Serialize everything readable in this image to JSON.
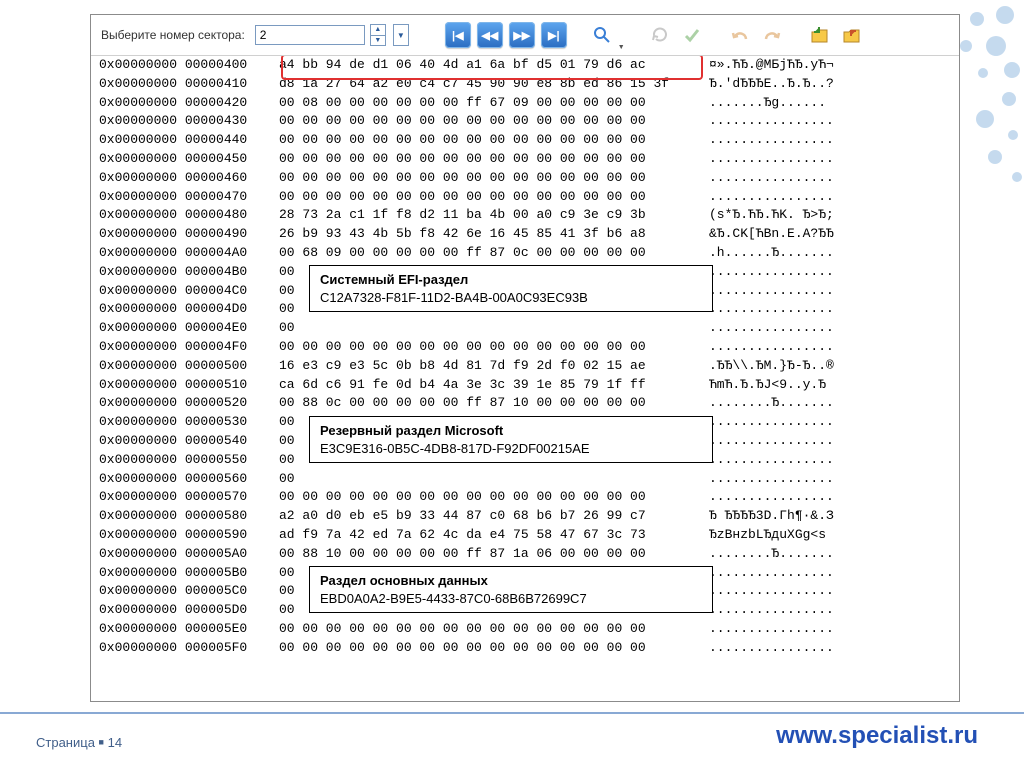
{
  "toolbar": {
    "sector_label": "Выберите номер сектора:",
    "sector_value": "2"
  },
  "hex": {
    "rows": [
      {
        "addr": "0x00000000 00000400",
        "bytes": "a4 bb 94 de d1 06 40 4d a1 6a bf d5 01 79 d6 ac",
        "ascii": "¤».ЋЂ.@МБjЋЂ.yЋ¬"
      },
      {
        "addr": "0x00000000 00000410",
        "bytes": "d8 1a 27 64 a2 e0 c4 c7 45 90 90 e8 8b ed 86 15 3f",
        "ascii": "Ђ.'dЂЂЂЕ..Ђ.Ђ..?"
      },
      {
        "addr": "0x00000000 00000420",
        "bytes": "00 08 00 00 00 00 00 00 ff 67 09 00 00 00 00 00",
        "ascii": ".......Ђg......"
      },
      {
        "addr": "0x00000000 00000430",
        "bytes": "00 00 00 00 00 00 00 00 00 00 00 00 00 00 00 00",
        "ascii": "................"
      },
      {
        "addr": "0x00000000 00000440",
        "bytes": "00 00 00 00 00 00 00 00 00 00 00 00 00 00 00 00",
        "ascii": "................"
      },
      {
        "addr": "0x00000000 00000450",
        "bytes": "00 00 00 00 00 00 00 00 00 00 00 00 00 00 00 00",
        "ascii": "................"
      },
      {
        "addr": "0x00000000 00000460",
        "bytes": "00 00 00 00 00 00 00 00 00 00 00 00 00 00 00 00",
        "ascii": "................"
      },
      {
        "addr": "0x00000000 00000470",
        "bytes": "00 00 00 00 00 00 00 00 00 00 00 00 00 00 00 00",
        "ascii": "................"
      },
      {
        "addr": "0x00000000 00000480",
        "bytes": "28 73 2a c1 1f f8 d2 11 ba 4b 00 a0 c9 3e c9 3b",
        "ascii": "(s*Ђ.ЋЂ.ЋK. Ђ>Ђ;"
      },
      {
        "addr": "0x00000000 00000490",
        "bytes": "26 b9 93 43 4b 5b f8 42 6e 16 45 85 41 3f b6 a8",
        "ascii": "&Ђ.CK[ЋBn.E.A?ЂЂ"
      },
      {
        "addr": "0x00000000 000004A0",
        "bytes": "00 68 09 00 00 00 00 00 ff 87 0c 00 00 00 00 00",
        "ascii": ".h......Ђ......."
      },
      {
        "addr": "0x00000000 000004B0",
        "bytes": "00 ",
        "ascii": "................"
      },
      {
        "addr": "0x00000000 000004C0",
        "bytes": "00 ",
        "ascii": "................"
      },
      {
        "addr": "0x00000000 000004D0",
        "bytes": "00 ",
        "ascii": "................"
      },
      {
        "addr": "0x00000000 000004E0",
        "bytes": "00 ",
        "ascii": "................"
      },
      {
        "addr": "0x00000000 000004F0",
        "bytes": "00 00 00 00 00 00 00 00 00 00 00 00 00 00 00 00",
        "ascii": "................"
      },
      {
        "addr": "0x00000000 00000500",
        "bytes": "16 e3 c9 e3 5c 0b b8 4d 81 7d f9 2d f0 02 15 ae",
        "ascii": ".ЂЂ\\\\.ЂM.}Ђ-Ђ..®"
      },
      {
        "addr": "0x00000000 00000510",
        "bytes": "ca 6d c6 91 fe 0d b4 4a 3e 3c 39 1e 85 79 1f ff",
        "ascii": "ЋmЋ.Ђ.ЂJ<9..y.Ђ"
      },
      {
        "addr": "0x00000000 00000520",
        "bytes": "00 88 0c 00 00 00 00 00 ff 87 10 00 00 00 00 00",
        "ascii": "........Ђ......."
      },
      {
        "addr": "0x00000000 00000530",
        "bytes": "00 ",
        "ascii": "................"
      },
      {
        "addr": "0x00000000 00000540",
        "bytes": "00 ",
        "ascii": "................"
      },
      {
        "addr": "0x00000000 00000550",
        "bytes": "00 ",
        "ascii": "................"
      },
      {
        "addr": "0x00000000 00000560",
        "bytes": "00 ",
        "ascii": "................"
      },
      {
        "addr": "0x00000000 00000570",
        "bytes": "00 00 00 00 00 00 00 00 00 00 00 00 00 00 00 00",
        "ascii": "................"
      },
      {
        "addr": "0x00000000 00000580",
        "bytes": "a2 a0 d0 eb e5 b9 33 44 87 c0 68 b6 b7 26 99 c7",
        "ascii": "Ђ ЂЂЂЂ3D.Гh¶·&.З"
      },
      {
        "addr": "0x00000000 00000590",
        "bytes": "ad f9 7a 42 ed 7a 62 4c da e4 75 58 47 67 3c 73",
        "ascii": "­ЂzBнzbLЂдuXGg<s"
      },
      {
        "addr": "0x00000000 000005A0",
        "bytes": "00 88 10 00 00 00 00 00 ff 87 1a 06 00 00 00 00",
        "ascii": "........Ђ......."
      },
      {
        "addr": "0x00000000 000005B0",
        "bytes": "00 ",
        "ascii": "................"
      },
      {
        "addr": "0x00000000 000005C0",
        "bytes": "00 ",
        "ascii": "................"
      },
      {
        "addr": "0x00000000 000005D0",
        "bytes": "00 ",
        "ascii": "................"
      },
      {
        "addr": "0x00000000 000005E0",
        "bytes": "00 00 00 00 00 00 00 00 00 00 00 00 00 00 00 00",
        "ascii": "................"
      },
      {
        "addr": "0x00000000 000005F0",
        "bytes": "00 00 00 00 00 00 00 00 00 00 00 00 00 00 00 00",
        "ascii": "................"
      }
    ]
  },
  "callouts": [
    {
      "title": "Системный EFI-раздел",
      "guid": "C12A7328-F81F-11D2-BA4B-00A0C93EC93B"
    },
    {
      "title": "Резервный раздел Microsoft",
      "guid": "E3C9E316-0B5C-4DB8-817D-F92DF00215AE"
    },
    {
      "title": "Раздел основных данных",
      "guid": "EBD0A0A2-B9E5-4433-87C0-68B6B72699C7"
    }
  ],
  "footer": {
    "page_label": "Страница",
    "page_num": "14",
    "url": "www.specialist.ru"
  }
}
